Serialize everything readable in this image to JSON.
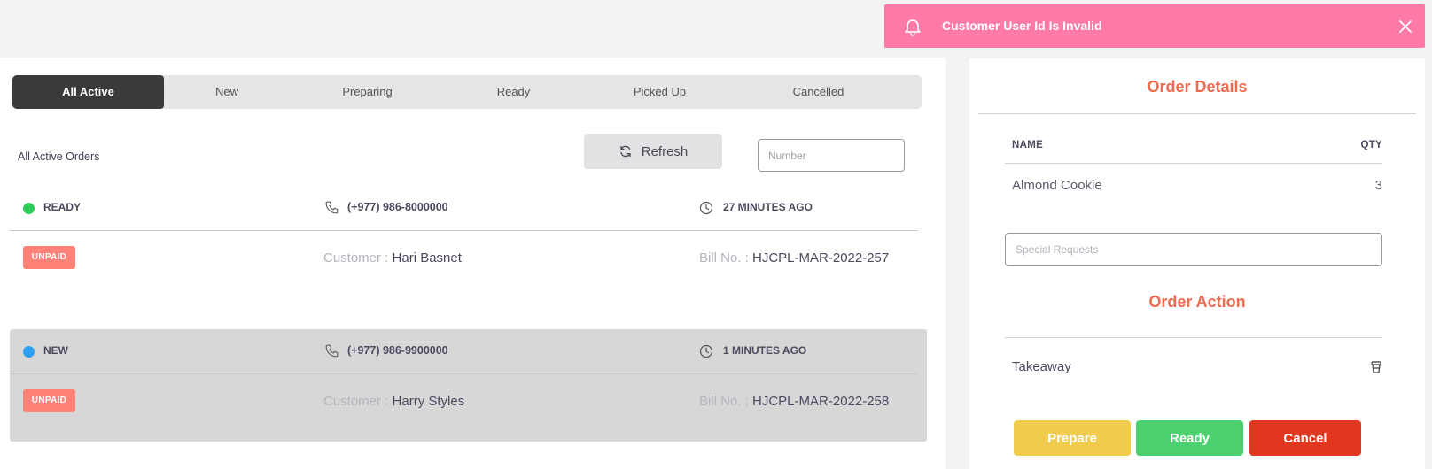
{
  "toast": {
    "message": "Customer User Id Is Invalid",
    "icon": "bell-icon",
    "close_icon": "close-icon",
    "color": "#ff7aa6"
  },
  "tabs": [
    {
      "label": "All Active",
      "active": true
    },
    {
      "label": "New"
    },
    {
      "label": "Preparing"
    },
    {
      "label": "Ready"
    },
    {
      "label": "Picked Up"
    },
    {
      "label": "Cancelled"
    }
  ],
  "orders_panel": {
    "title": "All Active Orders",
    "refresh_label": "Refresh",
    "number_placeholder": "Number"
  },
  "orders": [
    {
      "status": "READY",
      "status_color": "#2ecc5b",
      "phone": "(+977) 986-8000000",
      "time": "27 MINUTES AGO",
      "payment": "UNPAID",
      "customer_label": "Customer : ",
      "customer": "Hari Basnet",
      "bill_label": "Bill No. : ",
      "bill": "HJCPL-MAR-2022-257"
    },
    {
      "status": "NEW",
      "status_color": "#2e9ff0",
      "phone": "(+977) 986-9900000",
      "time": "1 MINUTES AGO",
      "payment": "UNPAID",
      "customer_label": "Customer : ",
      "customer": "Harry Styles",
      "bill_label": "Bill No. : ",
      "bill": "HJCPL-MAR-2022-258"
    }
  ],
  "details": {
    "title": "Order Details",
    "col_name": "NAME",
    "col_qty": "QTY",
    "items": [
      {
        "name": "Almond Cookie",
        "qty": "3"
      }
    ],
    "special_placeholder": "Special Requests",
    "action_title": "Order Action",
    "order_type": "Takeaway",
    "buttons": {
      "prepare": "Prepare",
      "prepare_color": "#f0cb4c",
      "ready": "Ready",
      "ready_color": "#4ccf6e",
      "cancel": "Cancel",
      "cancel_color": "#e1371f"
    }
  }
}
